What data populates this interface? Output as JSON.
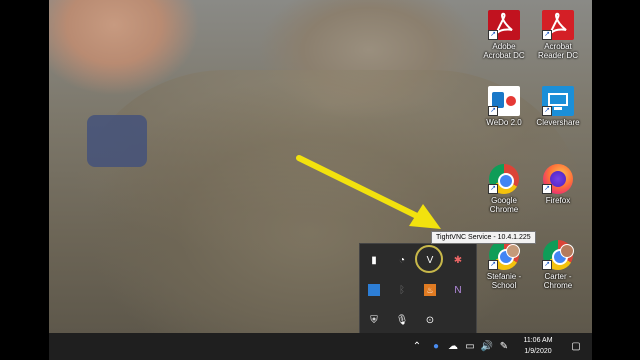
{
  "desktop": {
    "icons": [
      {
        "label": "Adobe\nAcrobat DC",
        "icon": "adobe-acrobat-icon"
      },
      {
        "label": "Acrobat\nReader DC",
        "icon": "acrobat-reader-icon"
      },
      {
        "label": "WeDo 2.0",
        "icon": "wedo-icon"
      },
      {
        "label": "Clevershare",
        "icon": "clevershare-icon"
      },
      {
        "label": "Google\nChrome",
        "icon": "chrome-icon"
      },
      {
        "label": "Firefox",
        "icon": "firefox-icon"
      },
      {
        "label": "Stefanie -\nSchool",
        "icon": "chrome-profile-icon"
      },
      {
        "label": "Carter -\nChrome",
        "icon": "chrome-profile-icon"
      }
    ]
  },
  "tooltip": {
    "text": "TightVNC Service - 10.4.1.225"
  },
  "tray_flyout": {
    "icons": [
      "usb-icon",
      "vnc-server-icon",
      "tightvnc-icon",
      "app-icon",
      "defender-icon",
      "bluetooth-icon",
      "java-icon",
      "onenote-icon",
      "security-shield-icon",
      "microphone-icon",
      "record-icon"
    ]
  },
  "taskbar": {
    "time": "11:06 AM",
    "date": "1/9/2020",
    "tray": [
      "chevron-up-icon",
      "network-icon",
      "cloud-icon",
      "network-wired-icon",
      "volume-icon",
      "pen-icon"
    ]
  },
  "colors": {
    "arrow": "#f2e20e",
    "taskbar": "#1f1f1f",
    "flyout": "#2b2b2b"
  }
}
